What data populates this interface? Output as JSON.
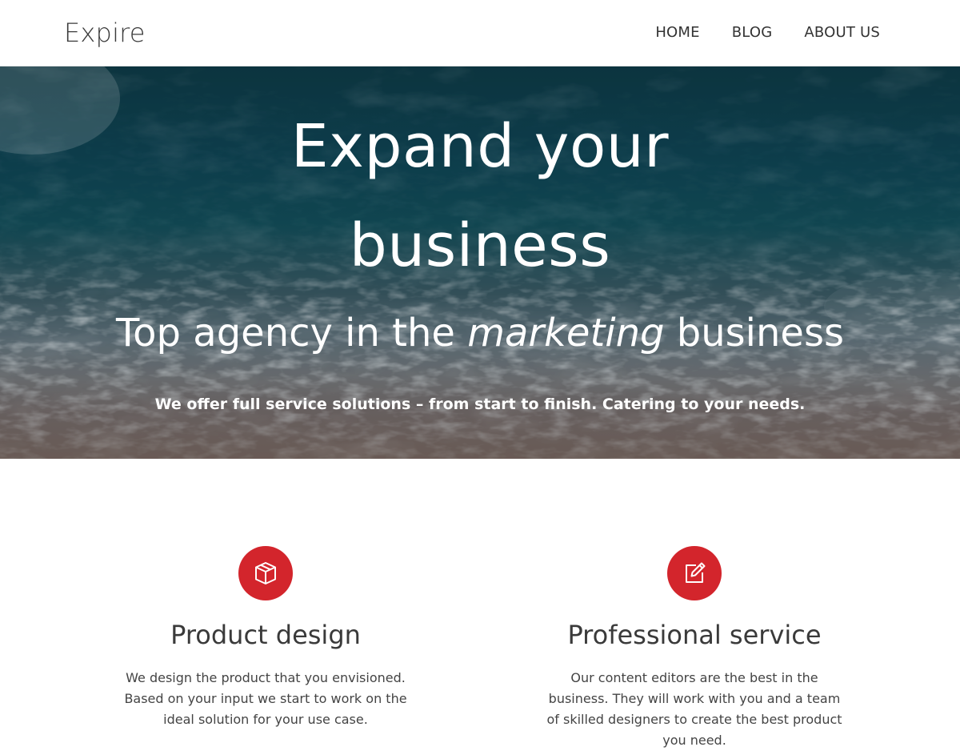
{
  "header": {
    "brand": "Expire",
    "nav": [
      "HOME",
      "BLOG",
      "ABOUT US"
    ]
  },
  "hero": {
    "title_line1": "Expand your",
    "title_line2": "business",
    "subtitle_before": "Top agency in the ",
    "subtitle_emphasis": "marketing",
    "subtitle_after": " business",
    "tagline": "We offer full service solutions – from start to finish. Catering to your needs."
  },
  "features": [
    {
      "icon": "box-icon",
      "title": "Product design",
      "text": "We design the product that you envisioned. Based on your input we start to work on the ideal solution for your use case."
    },
    {
      "icon": "edit-icon",
      "title": "Professional service",
      "text": "Our content editors are the best in the business. They will work with you and a team of skilled designers to create the best product you need."
    }
  ],
  "colors": {
    "accent": "#d3252c",
    "text": "#333333",
    "background": "#ffffff"
  }
}
